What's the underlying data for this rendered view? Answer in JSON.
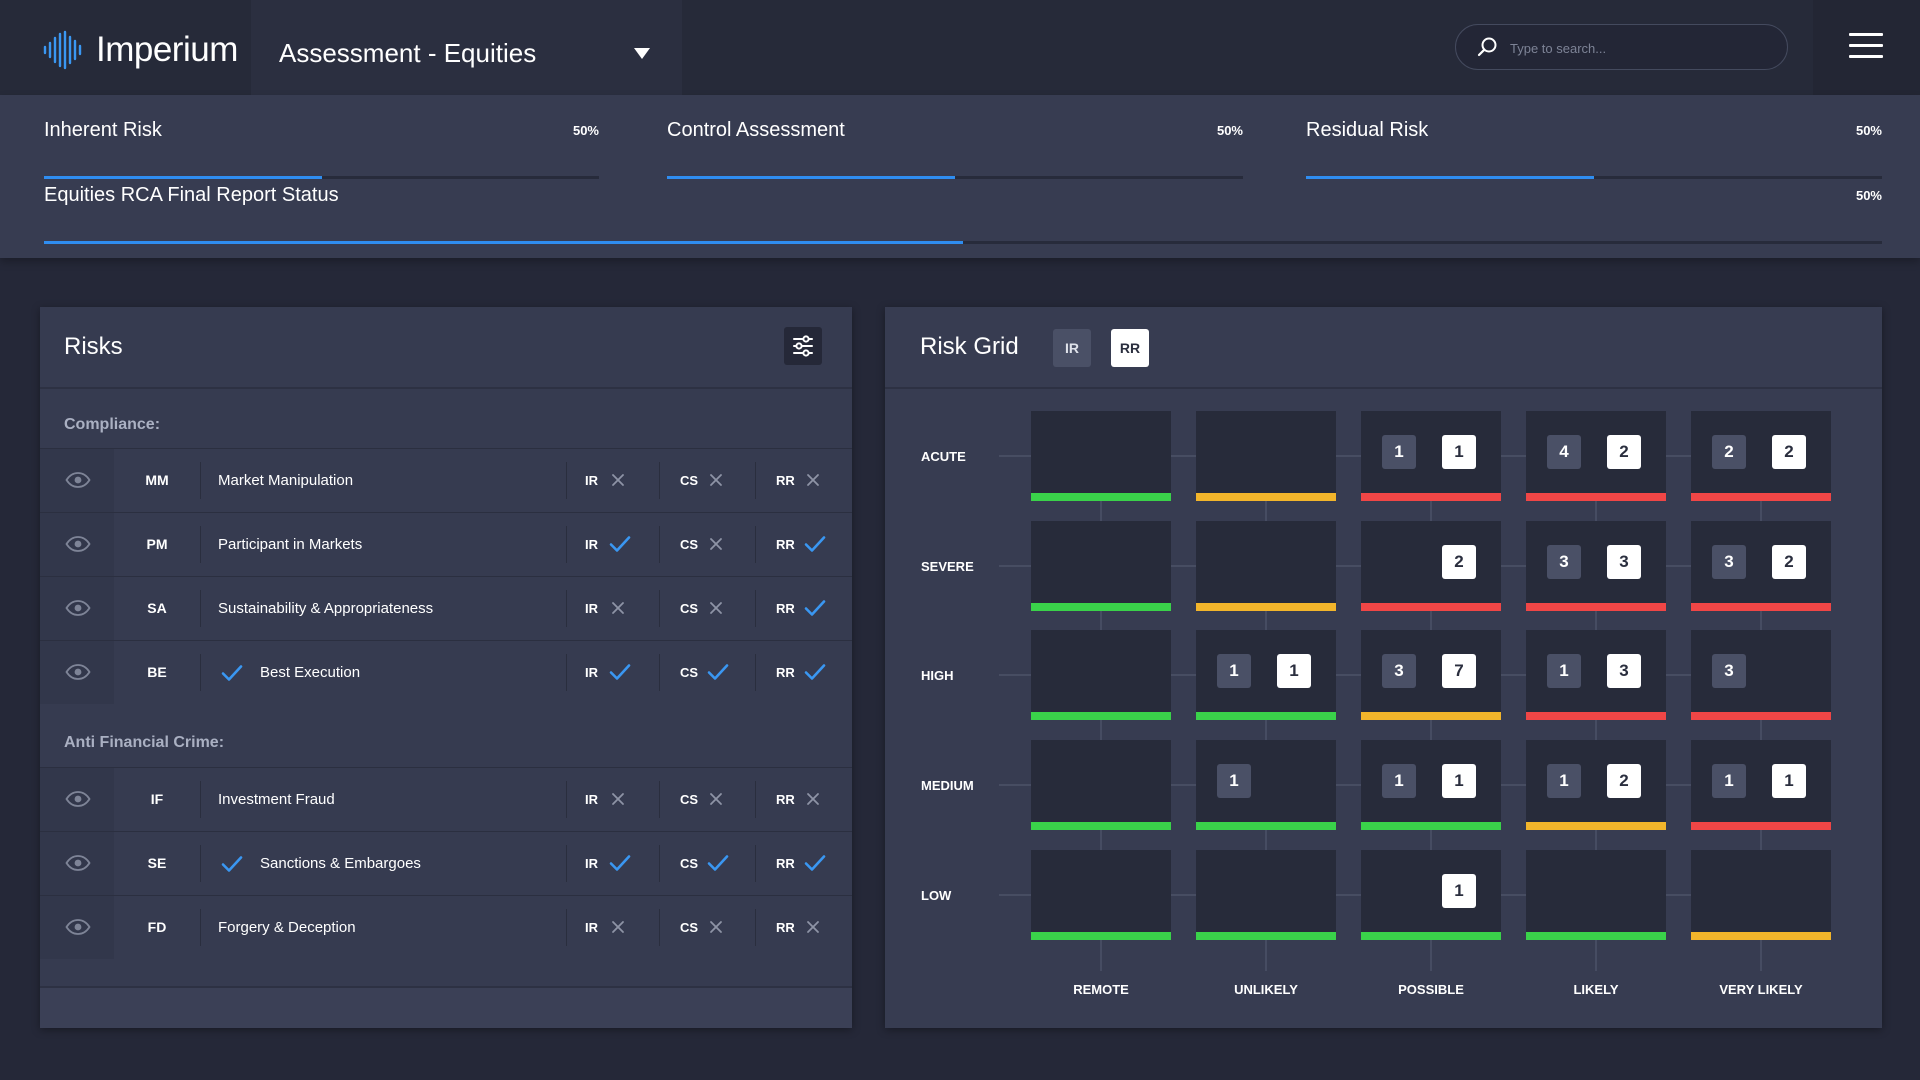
{
  "app": {
    "name": "Imperium"
  },
  "header": {
    "title": "Assessment - Equities",
    "search_placeholder": "Type to search...",
    "icons": [
      "logo-waveform-icon",
      "chevron-down-icon",
      "search-icon",
      "hamburger-menu-icon"
    ]
  },
  "progress": [
    {
      "label": "Inherent Risk",
      "percent_text": "50%",
      "fraction": 0.5
    },
    {
      "label": "Control Assessment",
      "percent_text": "50%",
      "fraction": 0.5
    },
    {
      "label": "Residual Risk",
      "percent_text": "50%",
      "fraction": 0.5
    },
    {
      "label": "Equities RCA Final Report Status",
      "percent_text": "50%",
      "fraction": 0.5
    }
  ],
  "risks": {
    "title": "Risks",
    "sections": [
      {
        "label": "Compliance:",
        "items": [
          {
            "code": "MM",
            "name": "Market Manipulation",
            "checked": false,
            "ir": false,
            "cs": false,
            "rr": false
          },
          {
            "code": "PM",
            "name": "Participant in Markets",
            "checked": false,
            "ir": true,
            "cs": false,
            "rr": true
          },
          {
            "code": "SA",
            "name": "Sustainability & Appropriateness",
            "checked": false,
            "ir": false,
            "cs": false,
            "rr": true
          },
          {
            "code": "BE",
            "name": "Best Execution",
            "checked": true,
            "ir": true,
            "cs": true,
            "rr": true
          }
        ]
      },
      {
        "label": "Anti Financial Crime:",
        "items": [
          {
            "code": "IF",
            "name": "Investment Fraud",
            "checked": false,
            "ir": false,
            "cs": false,
            "rr": false
          },
          {
            "code": "SE",
            "name": "Sanctions & Embargoes",
            "checked": true,
            "ir": true,
            "cs": true,
            "rr": true
          },
          {
            "code": "FD",
            "name": "Forgery & Deception",
            "checked": false,
            "ir": false,
            "cs": false,
            "rr": false
          }
        ]
      }
    ],
    "tags": {
      "ir": "IR",
      "cs": "CS",
      "rr": "RR"
    }
  },
  "risk_grid": {
    "title": "Risk Grid",
    "toggles": {
      "ir": "IR",
      "rr": "RR"
    },
    "active_toggle": "RR",
    "severity_levels": [
      "ACUTE",
      "SEVERE",
      "HIGH",
      "MEDIUM",
      "LOW"
    ],
    "likelihood_levels": [
      "REMOTE",
      "UNLIKELY",
      "POSSIBLE",
      "LIKELY",
      "VERY LIKELY"
    ],
    "colors": {
      "green": "#3ad24a",
      "amber": "#f2b52b",
      "red": "#f04646",
      "accent_blue": "#2f8df0",
      "check_blue": "#3a97f2"
    },
    "cells": [
      [
        {
          "color": "green",
          "ir": null,
          "rr": null
        },
        {
          "color": "amber",
          "ir": null,
          "rr": null
        },
        {
          "color": "red",
          "ir": "1",
          "rr": "1"
        },
        {
          "color": "red",
          "ir": "4",
          "rr": "2"
        },
        {
          "color": "red",
          "ir": "2",
          "rr": "2"
        }
      ],
      [
        {
          "color": "green",
          "ir": null,
          "rr": null
        },
        {
          "color": "amber",
          "ir": null,
          "rr": null
        },
        {
          "color": "red",
          "ir": null,
          "rr": "2"
        },
        {
          "color": "red",
          "ir": "3",
          "rr": "3"
        },
        {
          "color": "red",
          "ir": "3",
          "rr": "2"
        }
      ],
      [
        {
          "color": "green",
          "ir": null,
          "rr": null
        },
        {
          "color": "green",
          "ir": "1",
          "rr": "1"
        },
        {
          "color": "amber",
          "ir": "3",
          "rr": "7"
        },
        {
          "color": "red",
          "ir": "1",
          "rr": "3"
        },
        {
          "color": "red",
          "ir": "3",
          "rr": null
        }
      ],
      [
        {
          "color": "green",
          "ir": null,
          "rr": null
        },
        {
          "color": "green",
          "ir": "1",
          "rr": null
        },
        {
          "color": "green",
          "ir": "1",
          "rr": "1"
        },
        {
          "color": "amber",
          "ir": "1",
          "rr": "2"
        },
        {
          "color": "red",
          "ir": "1",
          "rr": "1"
        }
      ],
      [
        {
          "color": "green",
          "ir": null,
          "rr": null
        },
        {
          "color": "green",
          "ir": null,
          "rr": null
        },
        {
          "color": "green",
          "ir": null,
          "rr": "1"
        },
        {
          "color": "green",
          "ir": null,
          "rr": null
        },
        {
          "color": "amber",
          "ir": null,
          "rr": null
        }
      ]
    ]
  }
}
